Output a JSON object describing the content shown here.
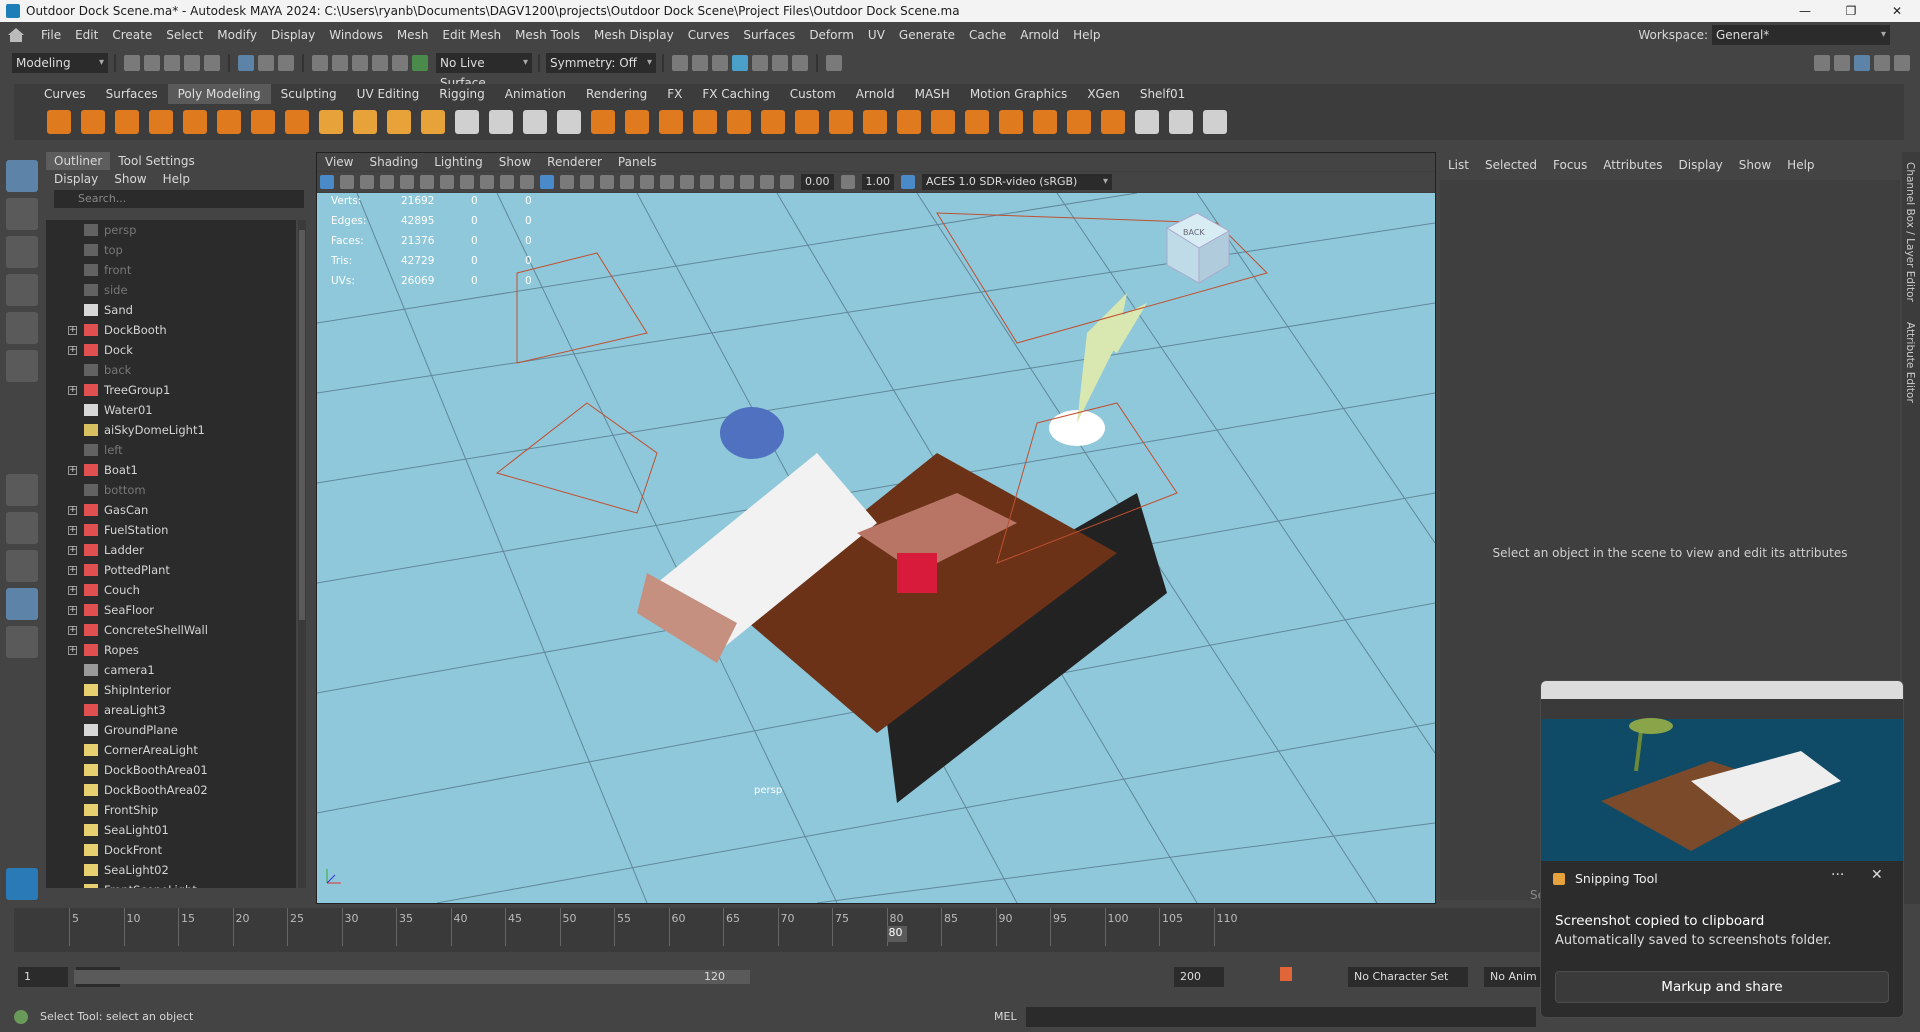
{
  "window": {
    "title": "Outdoor Dock Scene.ma* - Autodesk MAYA 2024: C:\\Users\\ryanb\\Documents\\DAGV1200\\projects\\Outdoor Dock Scene\\Project Files\\Outdoor Dock Scene.ma",
    "controls": [
      "—",
      "❐",
      "✕"
    ]
  },
  "menubar": {
    "items": [
      "File",
      "Edit",
      "Create",
      "Select",
      "Modify",
      "Display",
      "Windows",
      "Mesh",
      "Edit Mesh",
      "Mesh Tools",
      "Mesh Display",
      "Curves",
      "Surfaces",
      "Deform",
      "UV",
      "Generate",
      "Cache",
      "Arnold",
      "Help"
    ],
    "workspace_label": "Workspace:",
    "workspace_value": "General*"
  },
  "statusline": {
    "mode": "Modeling",
    "live_surface": "No Live Surface",
    "symmetry": "Symmetry: Off"
  },
  "shelf": {
    "tabs": [
      "Curves",
      "Surfaces",
      "Poly Modeling",
      "Sculpting",
      "UV Editing",
      "Rigging",
      "Animation",
      "Rendering",
      "FX",
      "FX Caching",
      "Custom",
      "Arnold",
      "MASH",
      "Motion Graphics",
      "XGen",
      "Shelf01"
    ],
    "active_tab": "Poly Modeling",
    "icon_colors": [
      "#e07a1e",
      "#e07a1e",
      "#e07a1e",
      "#e07a1e",
      "#e07a1e",
      "#e07a1e",
      "#e07a1e",
      "#e07a1e",
      "#e8a23a",
      "#e8a23a",
      "#e8a23a",
      "#e8a23a",
      "#d0d0d0",
      "#d0d0d0",
      "#d0d0d0",
      "#d0d0d0",
      "#e07a1e",
      "#e07a1e",
      "#e07a1e",
      "#e07a1e",
      "#e07a1e",
      "#e07a1e",
      "#e07a1e",
      "#e07a1e",
      "#e07a1e",
      "#e07a1e",
      "#e07a1e",
      "#e07a1e",
      "#e07a1e",
      "#e07a1e",
      "#e07a1e",
      "#e07a1e",
      "#d0d0d0",
      "#d0d0d0",
      "#d0d0d0"
    ]
  },
  "outliner": {
    "tabs": [
      "Outliner",
      "Tool Settings"
    ],
    "menu": [
      "Display",
      "Show",
      "Help"
    ],
    "search_placeholder": "Search...",
    "items": [
      {
        "label": "persp",
        "icon": "camera-icon",
        "dim": true,
        "expand": false
      },
      {
        "label": "top",
        "icon": "camera-icon",
        "dim": true,
        "expand": false
      },
      {
        "label": "front",
        "icon": "camera-icon",
        "dim": true,
        "expand": false
      },
      {
        "label": "side",
        "icon": "camera-icon",
        "dim": true,
        "expand": false
      },
      {
        "label": "Sand",
        "icon": "mesh-icon",
        "dim": false,
        "expand": false
      },
      {
        "label": "DockBooth",
        "icon": "group-icon",
        "dim": false,
        "expand": true
      },
      {
        "label": "Dock",
        "icon": "group-icon",
        "dim": false,
        "expand": true
      },
      {
        "label": "back",
        "icon": "camera-icon",
        "dim": true,
        "expand": false
      },
      {
        "label": "TreeGroup1",
        "icon": "group-icon",
        "dim": false,
        "expand": true
      },
      {
        "label": "Water01",
        "icon": "mesh-icon",
        "dim": false,
        "expand": false
      },
      {
        "label": "aiSkyDomeLight1",
        "icon": "skydome-icon",
        "dim": false,
        "expand": false
      },
      {
        "label": "left",
        "icon": "camera-icon",
        "dim": true,
        "expand": false
      },
      {
        "label": "Boat1",
        "icon": "group-icon",
        "dim": false,
        "expand": true
      },
      {
        "label": "bottom",
        "icon": "camera-icon",
        "dim": true,
        "expand": false
      },
      {
        "label": "GasCan",
        "icon": "group-icon",
        "dim": false,
        "expand": true
      },
      {
        "label": "FuelStation",
        "icon": "group-icon",
        "dim": false,
        "expand": true
      },
      {
        "label": "Ladder",
        "icon": "group-icon",
        "dim": false,
        "expand": true
      },
      {
        "label": "PottedPlant",
        "icon": "group-icon",
        "dim": false,
        "expand": true
      },
      {
        "label": "Couch",
        "icon": "group-icon",
        "dim": false,
        "expand": true
      },
      {
        "label": "SeaFloor",
        "icon": "group-icon",
        "dim": false,
        "expand": true
      },
      {
        "label": "ConcreteShellWall",
        "icon": "group-icon",
        "dim": false,
        "expand": true
      },
      {
        "label": "Ropes",
        "icon": "group-icon",
        "dim": false,
        "expand": true
      },
      {
        "label": "camera1",
        "icon": "camera-icon",
        "dim": false,
        "expand": false
      },
      {
        "label": "ShipInterior",
        "icon": "light-icon",
        "dim": false,
        "expand": false
      },
      {
        "label": "areaLight3",
        "icon": "group-icon",
        "dim": false,
        "expand": false
      },
      {
        "label": "GroundPlane",
        "icon": "mesh-icon",
        "dim": false,
        "expand": false
      },
      {
        "label": "CornerAreaLight",
        "icon": "light-icon",
        "dim": false,
        "expand": false
      },
      {
        "label": "DockBoothArea01",
        "icon": "light-icon",
        "dim": false,
        "expand": false
      },
      {
        "label": "DockBoothArea02",
        "icon": "light-icon",
        "dim": false,
        "expand": false
      },
      {
        "label": "FrontShip",
        "icon": "light-icon",
        "dim": false,
        "expand": false
      },
      {
        "label": "SeaLight01",
        "icon": "light-icon",
        "dim": false,
        "expand": false
      },
      {
        "label": "DockFront",
        "icon": "light-icon",
        "dim": false,
        "expand": false
      },
      {
        "label": "SeaLight02",
        "icon": "light-icon",
        "dim": false,
        "expand": false
      },
      {
        "label": "FrontSceneLight",
        "icon": "light-icon",
        "dim": false,
        "expand": false
      }
    ]
  },
  "viewport": {
    "menu": [
      "View",
      "Shading",
      "Lighting",
      "Show",
      "Renderer",
      "Panels"
    ],
    "exposure": "0.00",
    "gamma": "1.00",
    "color_space": "ACES 1.0 SDR-video (sRGB)",
    "camera_label": "persp",
    "hud": [
      {
        "label": "Verts:",
        "a": "21692",
        "b": "0",
        "c": "0"
      },
      {
        "label": "Edges:",
        "a": "42895",
        "b": "0",
        "c": "0"
      },
      {
        "label": "Faces:",
        "a": "21376",
        "b": "0",
        "c": "0"
      },
      {
        "label": "Tris:",
        "a": "42729",
        "b": "0",
        "c": "0"
      },
      {
        "label": "UVs:",
        "a": "26069",
        "b": "0",
        "c": "0"
      }
    ],
    "viewcube_label": "BACK",
    "background_color": "#8fc8da"
  },
  "attribute_editor": {
    "menu": [
      "List",
      "Selected",
      "Focus",
      "Attributes",
      "Display",
      "Show",
      "Help"
    ],
    "message": "Select an object in the scene to view and edit its attributes",
    "select_button": "Select",
    "side_tabs": [
      "Channel Box / Layer Editor",
      "Attribute Editor"
    ]
  },
  "timeline": {
    "ticks": [
      "5",
      "10",
      "15",
      "20",
      "25",
      "30",
      "35",
      "40",
      "45",
      "50",
      "55",
      "60",
      "65",
      "70",
      "75",
      "80",
      "85",
      "90",
      "95",
      "100",
      "105",
      "110"
    ],
    "current_frame": "80"
  },
  "range": {
    "start": "1",
    "inner_start": "1",
    "inner_end": "120",
    "end": "200",
    "character_set": "No Character Set",
    "anim_layer": "No Anim L"
  },
  "commandline": {
    "help_text": "Select Tool: select an object",
    "language": "MEL"
  },
  "snipping_toast": {
    "app": "Snipping Tool",
    "more": "···",
    "close": "✕",
    "line1": "Screenshot copied to clipboard",
    "line2": "Automatically saved to screenshots folder.",
    "button": "Markup and share"
  }
}
